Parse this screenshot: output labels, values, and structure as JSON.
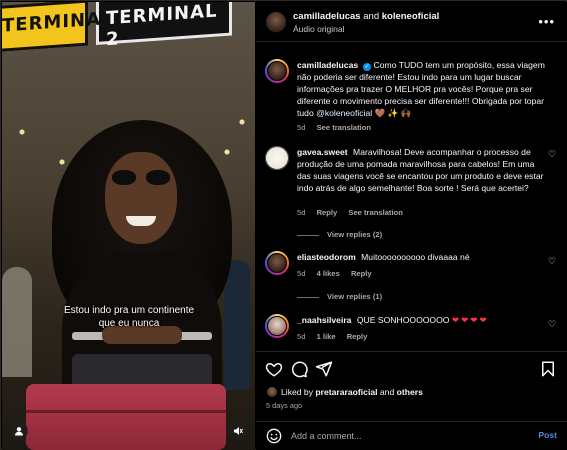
{
  "video": {
    "sign_left": "TERMINAL 2",
    "sign_right": "TERMINAL 2",
    "caption_line1": "Estou indo pra um continente",
    "caption_line2": "que eu nunca"
  },
  "header": {
    "user1": "camilladelucas",
    "and": "and",
    "user2": "koleneoficial",
    "audio": "Áudio original",
    "more": "•••"
  },
  "caption": {
    "user": "camilladelucas",
    "text": "Como TUDO tem um propósito, essa viagem não poderia ser diferente! Estou indo para um lugar buscar informações pra trazer O MELHOR pra vocês! Porque pra ser diferente o movimento precisa ser diferente!!! Obrigada por topar tudo ",
    "mention": "@koleneoficial",
    "emojis": " 🤎 ✨ 🙌🏾 ",
    "time": "5d",
    "see_translation": "See translation"
  },
  "comments": [
    {
      "user": "gavea.sweet",
      "text": "Maravilhosa! Deve acompanhar o processo de produção de uma pomada maravilhosa para cabelos! Em uma das suas viagens você se encantou por um produto e deve estar indo atrás de algo semelhante! Boa sorte ! Será que acertei?",
      "time": "5d",
      "reply": "Reply",
      "see_translation": "See translation",
      "view_replies": "View replies (2)"
    },
    {
      "user": "eliasteodorom",
      "text": "Muitoooooooooo divaaaa né",
      "time": "5d",
      "likes": "4 likes",
      "reply": "Reply",
      "view_replies": "View replies (1)"
    },
    {
      "user": "_naahsilveira",
      "text": "QUE SONHOOOOOOO",
      "hearts": "❤❤❤❤",
      "time": "5d",
      "likes": "1 like",
      "reply": "Reply"
    }
  ],
  "likes": {
    "prefix": "Liked by ",
    "user": "pretararaoficial",
    "and": " and ",
    "others": "others",
    "time": "5 days ago"
  },
  "add_comment": {
    "placeholder": "Add a comment...",
    "post": "Post"
  }
}
